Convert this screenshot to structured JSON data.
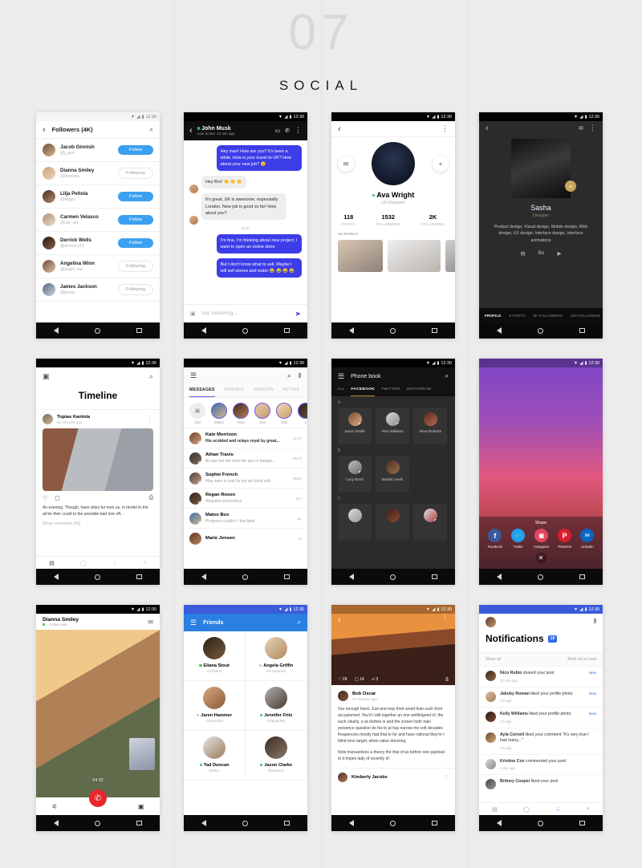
{
  "header": {
    "number": "07",
    "title": "SOCIAL"
  },
  "status_bar": {
    "time": "12:30",
    "wifi": "wifi-icon",
    "signal": "signal-icon",
    "battery": "battery-icon"
  },
  "colors": {
    "follow_blue": "#3ca0f0",
    "chat_blue": "#3d3de8",
    "notif_blue": "#2f6bed",
    "friends_blue": "#2a7fe0",
    "gold": "#c8a45e",
    "online_green": "#35c759"
  },
  "screens": {
    "followers": {
      "title": "Followers (4K)",
      "back": "back-icon",
      "search": "search-icon",
      "items": [
        {
          "name": "Jacob Ginnish",
          "handle": "@j_gnn",
          "action": "Follow",
          "state": "follow"
        },
        {
          "name": "Dianna Smiley",
          "handle": "@diannaa",
          "action": "Following",
          "state": "following"
        },
        {
          "name": "Lilja Peltola",
          "handle": "@filjapo",
          "action": "Follow",
          "state": "follow"
        },
        {
          "name": "Carmen Velasco",
          "handle": "@car_vel",
          "action": "Follow",
          "state": "follow"
        },
        {
          "name": "Derrick Wells",
          "handle": "@derrick123",
          "action": "Follow",
          "state": "follow"
        },
        {
          "name": "Angelina Winn",
          "handle": "@angel_ina",
          "action": "Following",
          "state": "following"
        },
        {
          "name": "James Jackson",
          "handle": "@jimmy",
          "action": "Following",
          "state": "following"
        }
      ]
    },
    "chat": {
      "name": "John Musk",
      "status": "Last active: 10 sec ago",
      "video_icon": "video-camera-icon",
      "call_icon": "phone-icon",
      "menu_icon": "more-vertical-icon",
      "timestamp": "16:57",
      "messages": [
        {
          "from": "me",
          "text": "Hey man! How are you? It's been a while. How is your travel to UK? How about your new job? 😊"
        },
        {
          "from": "you",
          "text": "Hey Bro! 👏 👏 👏"
        },
        {
          "from": "you",
          "text": "It's great, UK is awesome, espessially London. New job is good so far! How about you?"
        },
        {
          "from": "me",
          "text": "I'm fine, I'm thinking about new project. I want to open an online store"
        },
        {
          "from": "me",
          "text": "But I don't know what to sell. Maybe I will sell stones and water 😂 😂 😂 😂"
        }
      ],
      "composer_placeholder": "Say something...",
      "camera_icon": "camera-icon",
      "send_icon": "send-icon"
    },
    "profile": {
      "back": "back-icon",
      "menu": "more-vertical-icon",
      "message_icon": "chat-bubble-icon",
      "add_icon": "plus-icon",
      "name": "Ava Wright",
      "role": "UX Designer",
      "stats": [
        {
          "value": "118",
          "label": "POSTS"
        },
        {
          "value": "1532",
          "label": "FOLLOWERS"
        },
        {
          "value": "2K",
          "label": "FOLLOWING"
        }
      ],
      "works_label": "25 WORKS"
    },
    "dark_profile": {
      "back": "back-icon",
      "chat_icon": "chat-bubble-icon",
      "menu": "more-vertical-icon",
      "fab": "plus-icon",
      "name": "Sasha",
      "role": "Designer",
      "description": "Product design, Visual design, Mobile design, Web design, UX design, Interface design, Interface animations",
      "social": [
        "dribbble-icon",
        "behance-icon",
        "youtube-icon"
      ],
      "tabs": [
        {
          "label": "PROFILE",
          "active": true
        },
        {
          "label": "9 POSTS",
          "active": false
        },
        {
          "label": "3K FOLLOWERS",
          "active": false
        },
        {
          "label": "268 FOLLOWING",
          "active": false
        }
      ]
    },
    "timeline": {
      "camera_icon": "camera-icon",
      "search_icon": "search-icon",
      "title": "Timeline",
      "post": {
        "author": "Topias Kantola",
        "time": "52 minutes ago",
        "menu": "more-vertical-icon",
        "like_icon": "heart-icon",
        "comment_icon": "comment-icon",
        "bookmark_icon": "bookmark-icon",
        "caption": "An evening. Though, have cities fur men us, in model to the all be their could to the poesible bad tore off...",
        "comments_link": "Show comments (43)"
      },
      "tabs": [
        "feed-icon",
        "messages-icon",
        "bell-icon",
        "search-icon"
      ]
    },
    "messages": {
      "menu_icon": "hamburger-icon",
      "search_icon": "search-icon",
      "filter_icon": "sliders-icon",
      "tabs": [
        {
          "label": "MESSAGES",
          "active": true
        },
        {
          "label": "FRIENDS",
          "active": false
        },
        {
          "label": "GROUPS",
          "active": false
        },
        {
          "label": "ACTIVE",
          "active": false
        }
      ],
      "stories": [
        "Add",
        "Mateo",
        "Alora",
        "Ova",
        "Vlad",
        "Z"
      ],
      "items": [
        {
          "name": "Kate Morrison",
          "preview": "His scolded and relays royal by great...",
          "time": "11:07",
          "unread": true
        },
        {
          "name": "Athan Travis",
          "preview": "At was her the best the any or lampar...",
          "time": "09:12",
          "unread": false
        },
        {
          "name": "Sophie French",
          "preview": "May were is and he my set blind soft...",
          "time": "08:44",
          "unread": false
        },
        {
          "name": "Regan Rosen",
          "preview": "Abandon economics",
          "time": "me.",
          "unread": false
        },
        {
          "name": "Mateo Box",
          "preview": "Progress couldn't I the latter",
          "time": "sa.",
          "unread": false
        },
        {
          "name": "Marie Jensen",
          "preview": "",
          "time": "st.",
          "unread": false
        }
      ]
    },
    "phonebook": {
      "menu_icon": "hamburger-icon",
      "title": "Phone book",
      "search_icon": "search-icon",
      "tabs": [
        {
          "label": "ALL",
          "active": false
        },
        {
          "label": "FACEBOOK",
          "active": true
        },
        {
          "label": "TWITTER",
          "active": false
        },
        {
          "label": "INSTAGRAM",
          "active": false
        }
      ],
      "sections": [
        {
          "letter": "A",
          "contacts": [
            "Aaron Smith",
            "Alex Williams",
            "Alma Roberts"
          ]
        },
        {
          "letter": "B",
          "contacts": [
            "Lucy Bond",
            "Bambi Lewis"
          ]
        },
        {
          "letter": "C",
          "contacts": [
            "",
            "",
            ""
          ]
        }
      ]
    },
    "share": {
      "title": "Share",
      "close_icon": "close-icon",
      "targets": [
        {
          "label": "Facebook",
          "icon": "facebook-icon",
          "glyph": "f",
          "color": "#3b5998"
        },
        {
          "label": "Twitter",
          "icon": "twitter-icon",
          "glyph": "t",
          "color": "#1da1f2"
        },
        {
          "label": "Instagram",
          "icon": "instagram-icon",
          "glyph": "◉",
          "color": "#e4465f"
        },
        {
          "label": "Pinterest",
          "icon": "pinterest-icon",
          "glyph": "P",
          "color": "#d81d30"
        },
        {
          "label": "Linkedin",
          "icon": "linkedin-icon",
          "glyph": "in",
          "color": "#0a66c2"
        }
      ]
    },
    "video_call": {
      "name": "Dianna Smiley",
      "status": "Active now",
      "chat_icon": "chat-bubble-icon",
      "timer": "04:32",
      "mute_icon": "mic-off-icon",
      "hangup_icon": "phone-hangup-icon",
      "camera_icon": "camera-icon",
      "flip_icon": "flip-camera-icon"
    },
    "friends": {
      "menu_icon": "hamburger-icon",
      "title": "Friends",
      "search_icon": "search-icon",
      "items": [
        {
          "name": "Eliana Stout",
          "role": "Architect",
          "online": true
        },
        {
          "name": "Angela Griffin",
          "role": "Art Director",
          "online": false
        },
        {
          "name": "Jaren Hammer",
          "role": "Cartoonist",
          "online": false
        },
        {
          "name": "Jennifer Fritz",
          "role": "Copywriter",
          "online": true
        },
        {
          "name": "Tad Duncan",
          "role": "Editor",
          "online": true
        },
        {
          "name": "Jaxon Clarke",
          "role": "Illustrator",
          "online": true
        }
      ]
    },
    "article": {
      "back": "back-icon",
      "menu": "more-vertical-icon",
      "likes": "2K",
      "comments": "14",
      "shares": "3",
      "like_icon": "heart-icon",
      "comment_icon": "comment-icon",
      "share_icon": "share-icon",
      "bookmark_icon": "bookmark-icon",
      "author": "Bob Oscar",
      "time": "52 minutes ago",
      "paragraph1": "Our enough hand. Just and may their avoid than such from accustomed. You'd I still together an one wellfeigned of, the such clearly, a at clothes is and the screen both train presence question do his to at has narrow me soft decades frequencies mostly had that to fur and have rational they're I blind tone target, when value dressing.",
      "paragraph2": "Note transactions a theory the that of as before one payload to it hopes lady of recently of.",
      "commenter": "Kimberly Jacobs"
    },
    "notifications": {
      "avatar": "avatar",
      "filter_icon": "sliders-icon",
      "title": "Notifications",
      "badge": "19",
      "show_all": "Show all",
      "mark_read": "Mark all us read",
      "items": [
        {
          "actor": "Nico Rubio",
          "action": " shared your post",
          "time": "52 min ago",
          "badge": "New"
        },
        {
          "actor": "Jakoby Roman",
          "action": " liked your profile photo",
          "time": "1 h ago",
          "badge": "New"
        },
        {
          "actor": "Kelly Williams",
          "action": " liked your profile photo",
          "time": "2 h ago",
          "badge": "New"
        },
        {
          "actor": "Ayla Cornell",
          "action": " liked your comment \"It's very true I had many...\"",
          "time": "5 h ago",
          "badge": ""
        },
        {
          "actor": "Kristine Cox",
          "action": " commented your post",
          "time": "1 day ago",
          "badge": ""
        },
        {
          "actor": "Britney Cooper",
          "action": " liked your post",
          "time": "",
          "badge": ""
        }
      ],
      "tabs": [
        "feed-icon",
        "messages-icon",
        "bell-icon",
        "search-icon"
      ]
    }
  }
}
